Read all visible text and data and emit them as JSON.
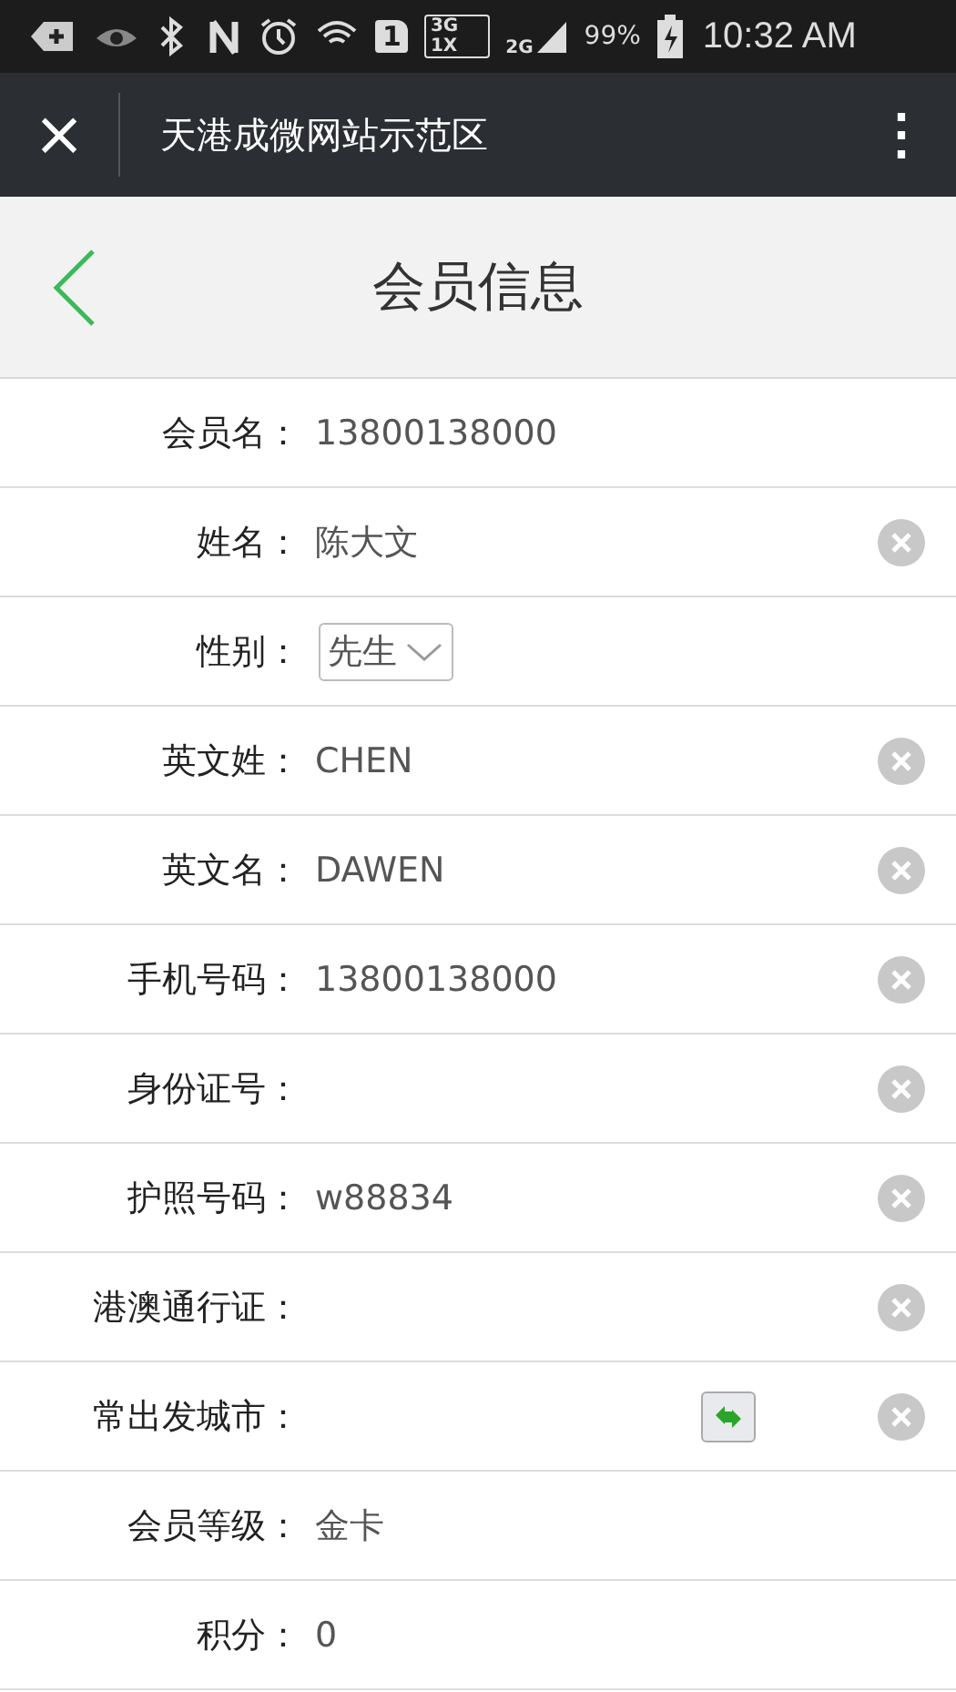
{
  "status_bar": {
    "network_3g": "3G",
    "network_1x": "1X",
    "network_2g": "2G",
    "sim": "1",
    "battery": "99%",
    "time": "10:32 AM"
  },
  "title_bar": {
    "close": "×",
    "title": "天港成微网站示范区",
    "menu": "⋮"
  },
  "header": {
    "title": "会员信息"
  },
  "fields": [
    {
      "kind": "text",
      "label": "会员名：",
      "value": "13800138000",
      "clearable": false
    },
    {
      "kind": "text",
      "label": "姓名：",
      "value": "陈大文",
      "clearable": true
    },
    {
      "kind": "select",
      "label": "性别：",
      "value": "先生",
      "clearable": false
    },
    {
      "kind": "text",
      "label": "英文姓：",
      "value": "CHEN",
      "clearable": true
    },
    {
      "kind": "text",
      "label": "英文名：",
      "value": "DAWEN",
      "clearable": true
    },
    {
      "kind": "text",
      "label": "手机号码：",
      "value": "13800138000",
      "clearable": true
    },
    {
      "kind": "text",
      "label": "身份证号：",
      "clearable": true
    },
    {
      "kind": "text",
      "label": "护照号码：",
      "value": "w88834",
      "clearable": true
    },
    {
      "kind": "text",
      "label": "港澳通行证：",
      "clearable": true
    },
    {
      "kind": "city",
      "label": "常出发城市：",
      "clearable": true
    },
    {
      "kind": "text",
      "label": "会员等级：",
      "value": "金卡",
      "clearable": false
    },
    {
      "kind": "text",
      "label": "积分：",
      "value": "0",
      "clearable": false
    }
  ]
}
